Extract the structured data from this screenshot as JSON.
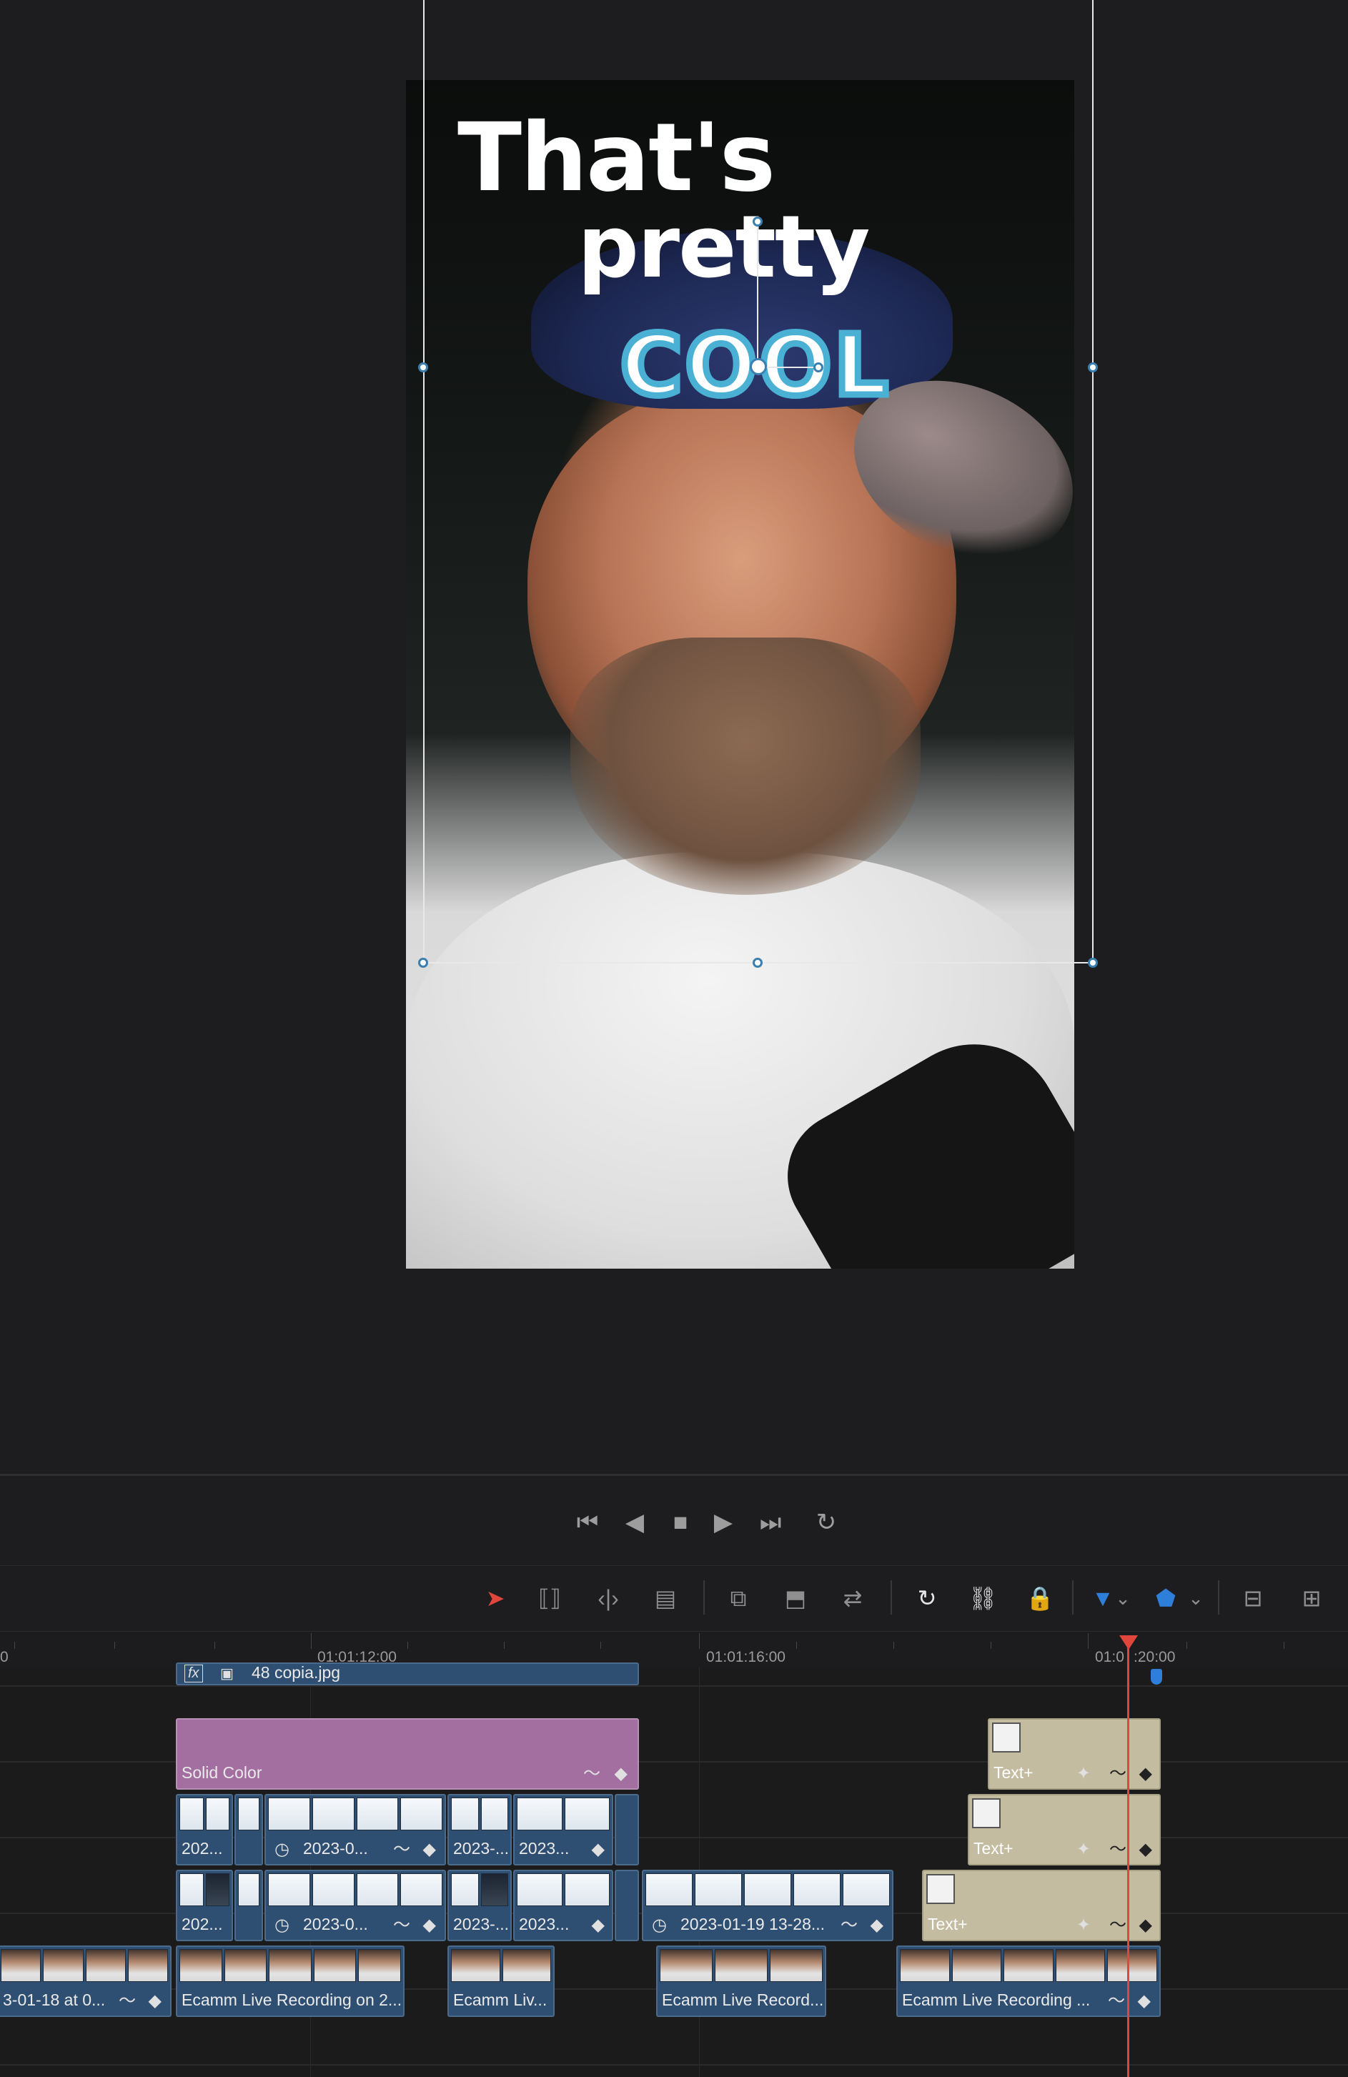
{
  "viewer": {
    "caption_line1": "That's",
    "caption_line2": "pretty",
    "caption_line3": "COOL"
  },
  "transport": {
    "buttons": [
      "go-to-start",
      "step-back",
      "stop",
      "play",
      "go-to-end",
      "loop"
    ],
    "icons": {
      "first": "⏮",
      "back": "◀",
      "stop": "■",
      "play": "▶",
      "last": "⏭",
      "loop": "↻"
    }
  },
  "toolbar": {
    "tools": [
      "selection",
      "trim",
      "dynamic-trim",
      "blade",
      "insert",
      "overwrite",
      "replace",
      "snapping",
      "linked-selection",
      "position-lock",
      "flag",
      "marker",
      "zoom-full",
      "zoom-detail"
    ],
    "glyphs": {
      "select": "➤",
      "trim": "⟦⟧",
      "dyn": "‹|›",
      "blade": "▤",
      "insert": "⧉",
      "overwrite": "⬒",
      "replace": "⇄",
      "snap": "↻",
      "link": "⛓",
      "lock": "🔒",
      "flag": "▼",
      "chevron": "⌄",
      "marker": "⬟",
      "zoom1": "⊟",
      "zoom2": "⊞"
    },
    "accent": "#2e7fd9",
    "select_color": "#e0463c"
  },
  "timeline": {
    "timecodes": [
      "0",
      "01:01:12:00",
      "01:01:16:00",
      "01:0",
      ":20:00"
    ],
    "clips": {
      "v5_label": "48 copia.jpg",
      "v5_fx": "fx",
      "solid_label": "Solid Color",
      "text1": "Text+",
      "text2": "Text+",
      "text3": "Text+",
      "v3_a": "202...",
      "v3_b": "2023-0...",
      "v3_c": "2023-...",
      "v3_d": "2023...",
      "v2_a": "202...",
      "v2_b": "2023-0...",
      "v2_c": "2023-...",
      "v2_d": "2023...",
      "v2_e": "2023-01-19 13-28...",
      "v1_a": "3-01-18 at 0...",
      "v1_b": "Ecamm Live Recording on 2...",
      "v1_c": "Ecamm Liv...",
      "v1_d": "Ecamm Live Record...",
      "v1_e": "Ecamm Live Recording ..."
    },
    "clip_icons": {
      "curve": "〜",
      "keyframe": "◆",
      "speed": "◷",
      "sparkle": "✦"
    },
    "colors": {
      "video_clip": "#2f4f72",
      "text_clip": "#c3bca1",
      "solid_clip": "#a36fa0",
      "playhead": "#e0463c"
    }
  }
}
